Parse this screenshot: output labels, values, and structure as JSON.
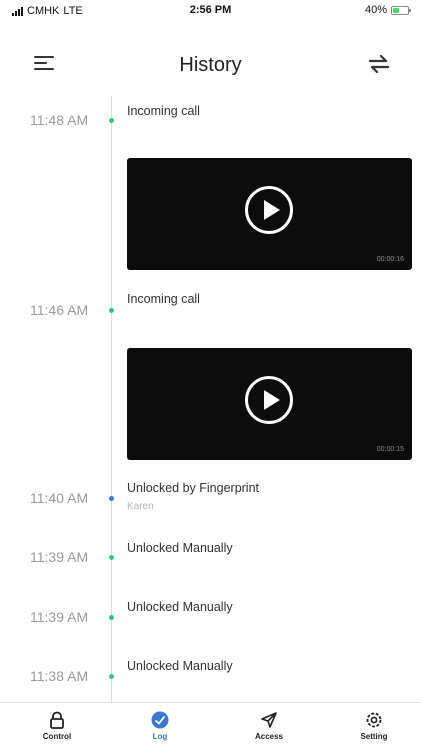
{
  "status_bar": {
    "carrier": "CMHK",
    "network": "LTE",
    "time": "2:56 PM",
    "battery_percent": "40%",
    "battery_level": 0.4
  },
  "header": {
    "title": "History",
    "menu_icon": "menu-icon",
    "swap_icon": "swap-arrows-icon"
  },
  "entries": [
    {
      "time": "11:48 AM",
      "text": "Incoming call",
      "sub": "",
      "dot_color": "#2ecc71",
      "video_duration": "00:00:16"
    },
    {
      "time": "11:46 AM",
      "text": "Incoming call",
      "sub": "",
      "dot_color": "#2ecc71",
      "video_duration": "00:00:15"
    },
    {
      "time": "11:40 AM",
      "text": "Unlocked by Fingerprint",
      "sub": "Karen",
      "dot_color": "#3a78c9"
    },
    {
      "time": "11:39 AM",
      "text": "Unlocked Manually",
      "sub": "",
      "dot_color": "#2ecc71"
    },
    {
      "time": "11:39 AM",
      "text": "Unlocked Manually",
      "sub": "",
      "dot_color": "#2ecc71"
    },
    {
      "time": "11:38 AM",
      "text": "Unlocked Manually",
      "sub": "",
      "dot_color": "#2ecc71"
    }
  ],
  "tabs": [
    {
      "label": "Control",
      "icon": "lock-icon",
      "active": false
    },
    {
      "label": "Log",
      "icon": "log-icon",
      "active": true
    },
    {
      "label": "Access",
      "icon": "send-icon",
      "active": false
    },
    {
      "label": "Setting",
      "icon": "gear-icon",
      "active": false
    }
  ],
  "colors": {
    "accent": "#3a78c9",
    "green_dot": "#2ecc71",
    "video_bg": "#0c0c0c"
  }
}
